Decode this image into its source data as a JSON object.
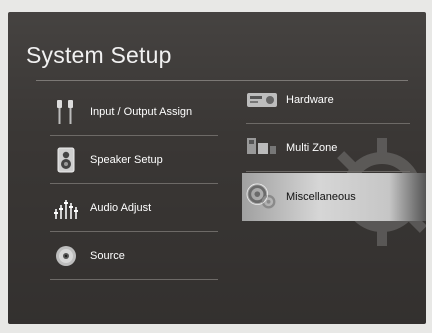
{
  "screen": {
    "title": "System Setup"
  },
  "menu": {
    "left": [
      {
        "label": "Input / Output Assign",
        "icon": "cable-plugs-icon"
      },
      {
        "label": "Speaker Setup",
        "icon": "speaker-icon"
      },
      {
        "label": "Audio Adjust",
        "icon": "sliders-icon"
      },
      {
        "label": "Source",
        "icon": "disc-icon"
      }
    ],
    "right": [
      {
        "label": "Hardware",
        "icon": "av-receiver-icon"
      },
      {
        "label": "Multi Zone",
        "icon": "multi-zone-icon"
      },
      {
        "label": "Miscellaneous",
        "icon": "gears-icon",
        "selected": true
      }
    ]
  },
  "colors": {
    "background": "#3a3735",
    "highlight": "#d6d6d6",
    "text": "#ffffff"
  }
}
